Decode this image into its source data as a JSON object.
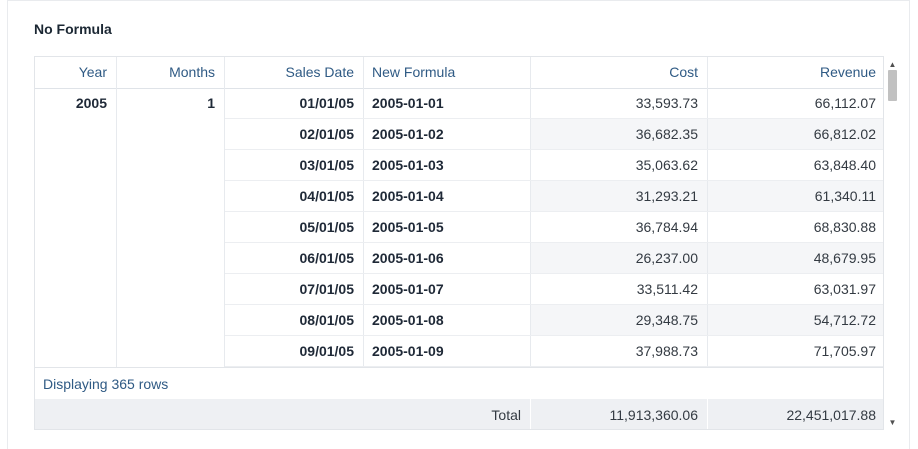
{
  "panel": {
    "title": "No Formula"
  },
  "table": {
    "columns": {
      "year": "Year",
      "months": "Months",
      "sales_date": "Sales Date",
      "new_formula": "New Formula",
      "cost": "Cost",
      "revenue": "Revenue"
    },
    "group": {
      "year": "2005",
      "months": "1"
    },
    "rows": [
      {
        "sales_date": "01/01/05",
        "new_formula": "2005-01-01",
        "cost": "33,593.73",
        "revenue": "66,112.07"
      },
      {
        "sales_date": "02/01/05",
        "new_formula": "2005-01-02",
        "cost": "36,682.35",
        "revenue": "66,812.02"
      },
      {
        "sales_date": "03/01/05",
        "new_formula": "2005-01-03",
        "cost": "35,063.62",
        "revenue": "63,848.40"
      },
      {
        "sales_date": "04/01/05",
        "new_formula": "2005-01-04",
        "cost": "31,293.21",
        "revenue": "61,340.11"
      },
      {
        "sales_date": "05/01/05",
        "new_formula": "2005-01-05",
        "cost": "36,784.94",
        "revenue": "68,830.88"
      },
      {
        "sales_date": "06/01/05",
        "new_formula": "2005-01-06",
        "cost": "26,237.00",
        "revenue": "48,679.95"
      },
      {
        "sales_date": "07/01/05",
        "new_formula": "2005-01-07",
        "cost": "33,511.42",
        "revenue": "63,031.97"
      },
      {
        "sales_date": "08/01/05",
        "new_formula": "2005-01-08",
        "cost": "29,348.75",
        "revenue": "54,712.72"
      },
      {
        "sales_date": "09/01/05",
        "new_formula": "2005-01-09",
        "cost": "37,988.73",
        "revenue": "71,705.97"
      }
    ],
    "status": "Displaying 365 rows",
    "totals": {
      "label": "Total",
      "cost": "11,913,360.06",
      "revenue": "22,451,017.88"
    }
  },
  "scrollbar": {
    "up_icon": "▲",
    "down_icon": "▼"
  }
}
